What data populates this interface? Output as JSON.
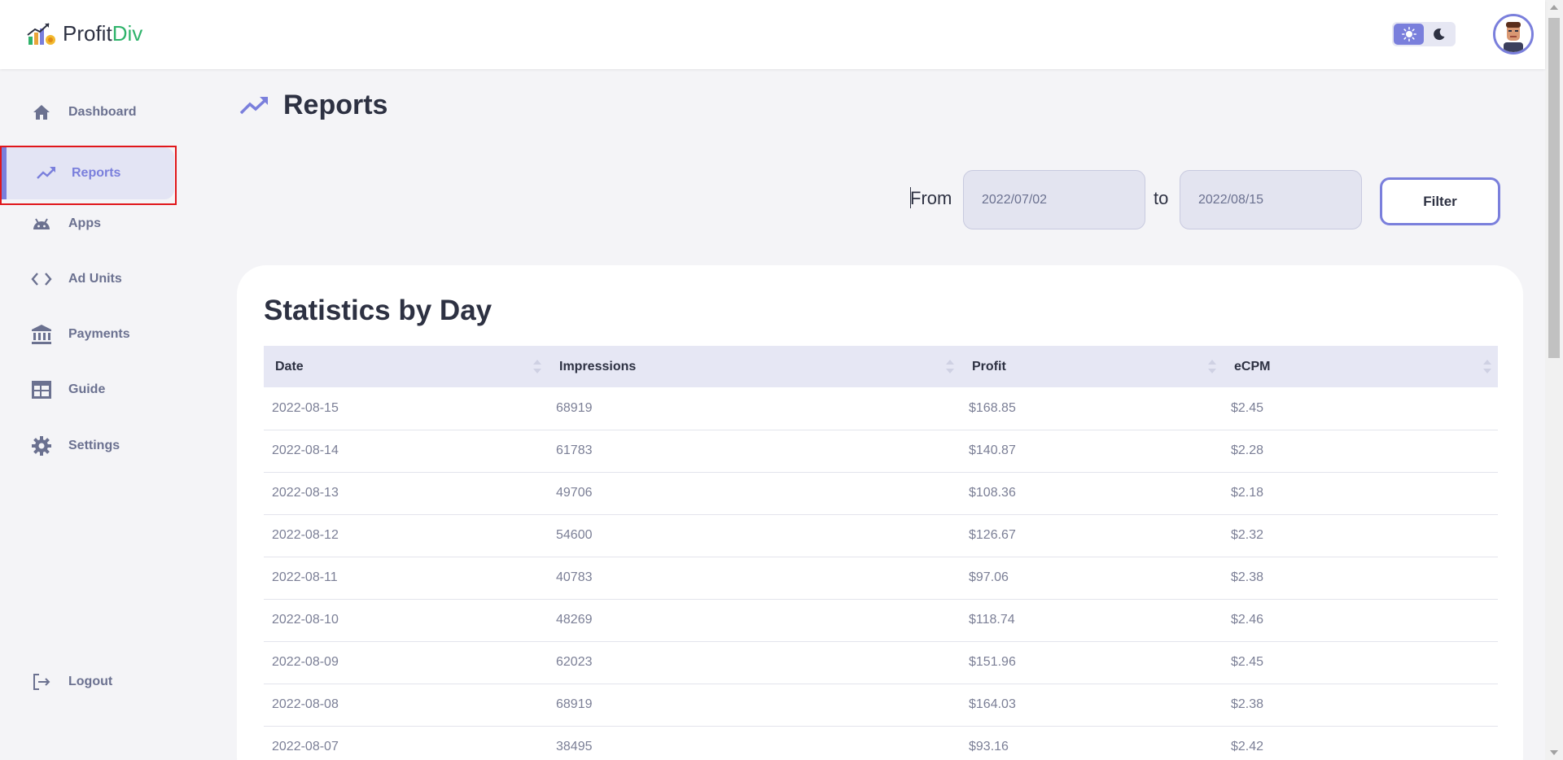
{
  "app": {
    "logo_main": "Profit",
    "logo_accent": "Div"
  },
  "header": {
    "theme_light": "light-mode",
    "theme_dark": "dark-mode"
  },
  "sidebar": {
    "items": [
      {
        "label": "Dashboard",
        "icon": "home-icon"
      },
      {
        "label": "Reports",
        "icon": "trending-up-icon",
        "active": true
      },
      {
        "label": "Apps",
        "icon": "android-icon"
      },
      {
        "label": "Ad Units",
        "icon": "code-icon"
      },
      {
        "label": "Payments",
        "icon": "bank-icon"
      },
      {
        "label": "Guide",
        "icon": "table-icon"
      },
      {
        "label": "Settings",
        "icon": "gear-icon"
      }
    ],
    "logout": {
      "label": "Logout",
      "icon": "logout-icon"
    }
  },
  "page": {
    "title": "Reports"
  },
  "filter": {
    "from_label": "From",
    "from_value": "2022/07/02",
    "to_label": "to",
    "to_value": "2022/08/15",
    "button_label": "Filter"
  },
  "stats": {
    "title": "Statistics by Day",
    "columns": [
      "Date",
      "Impressions",
      "Profit",
      "eCPM"
    ],
    "rows": [
      [
        "2022-08-15",
        "68919",
        "$168.85",
        "$2.45"
      ],
      [
        "2022-08-14",
        "61783",
        "$140.87",
        "$2.28"
      ],
      [
        "2022-08-13",
        "49706",
        "$108.36",
        "$2.18"
      ],
      [
        "2022-08-12",
        "54600",
        "$126.67",
        "$2.32"
      ],
      [
        "2022-08-11",
        "40783",
        "$97.06",
        "$2.38"
      ],
      [
        "2022-08-10",
        "48269",
        "$118.74",
        "$2.46"
      ],
      [
        "2022-08-09",
        "62023",
        "$151.96",
        "$2.45"
      ],
      [
        "2022-08-08",
        "68919",
        "$164.03",
        "$2.38"
      ],
      [
        "2022-08-07",
        "38495",
        "$93.16",
        "$2.42"
      ]
    ]
  },
  "colors": {
    "accent": "#7a7fdc",
    "brand_green": "#2fb36b",
    "highlight_outline": "#e0161b"
  }
}
